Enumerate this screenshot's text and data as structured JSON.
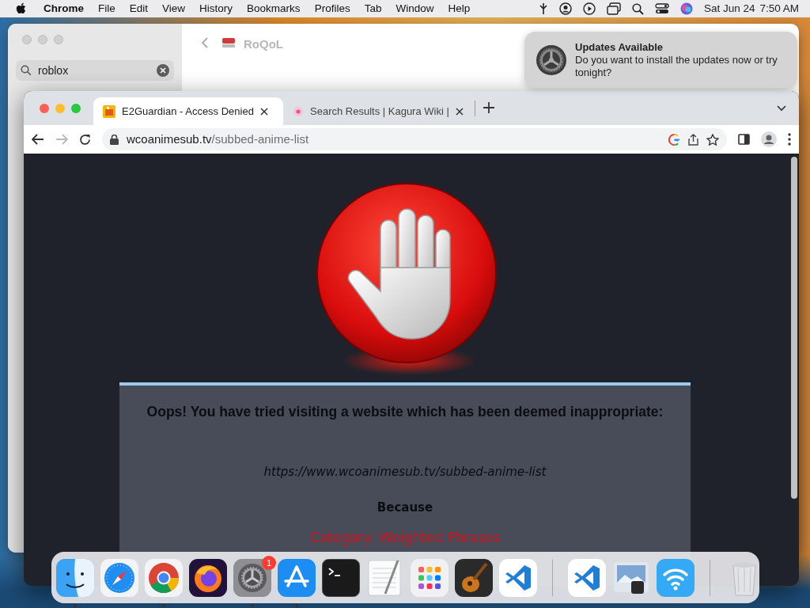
{
  "menu_bar": {
    "app": "Chrome",
    "menus": [
      "File",
      "Edit",
      "View",
      "History",
      "Bookmarks",
      "Profiles",
      "Tab",
      "Window",
      "Help"
    ],
    "date": "Sat Jun 24",
    "time": "7:50 AM"
  },
  "settings_window": {
    "search": {
      "value": "roblox"
    },
    "page_title": "RoQoL"
  },
  "notification": {
    "title": "Updates Available",
    "body": "Do you want to install the updates now or try tonight?"
  },
  "browser": {
    "tabs": [
      {
        "title": "E2Guardian - Access Denied",
        "selected": true,
        "kind": "guardian"
      },
      {
        "title": "Search Results | Kagura Wiki |",
        "selected": false,
        "kind": "wiki"
      }
    ],
    "address": {
      "host": "wcoanimesub.tv",
      "path": "/subbed-anime-list"
    }
  },
  "block_page": {
    "heading": "Oops! You have tried visiting a website which has been deemed inappropriate:",
    "url": "https://www.wcoanimesub.tv/subbed-anime-list",
    "because": "Because",
    "reasons": [
      "Category: Weighted Phrases"
    ]
  },
  "dock": {
    "items": [
      {
        "kind": "finder",
        "running": true
      },
      {
        "kind": "safari",
        "running": false
      },
      {
        "kind": "chrome",
        "running": true
      },
      {
        "kind": "firefox",
        "running": false
      },
      {
        "kind": "settings",
        "running": true,
        "badge": "1"
      },
      {
        "kind": "appstore",
        "running": true
      },
      {
        "kind": "terminal",
        "running": false
      },
      {
        "kind": "textedit",
        "running": false
      },
      {
        "kind": "launchpad",
        "running": false
      },
      {
        "kind": "garageband",
        "running": false
      },
      {
        "kind": "vscode",
        "running": false
      },
      {
        "kind": "separator"
      },
      {
        "kind": "vscode",
        "running": false
      },
      {
        "kind": "preview",
        "running": false
      },
      {
        "kind": "wifi",
        "running": false
      },
      {
        "kind": "separator"
      },
      {
        "kind": "trash",
        "running": false
      }
    ]
  }
}
